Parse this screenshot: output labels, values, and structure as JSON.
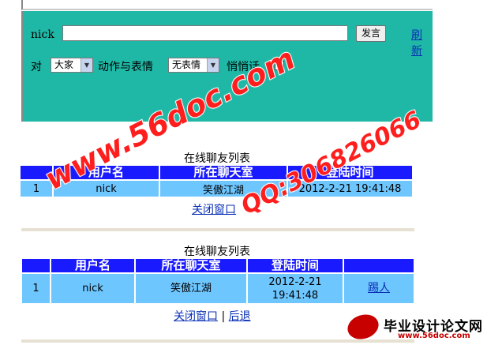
{
  "chat": {
    "nick_label": "nick",
    "message_value": "",
    "speak_button": "发言",
    "refresh_link": "刷新",
    "to_label": "对",
    "target_select": "大家",
    "action_label": "动作与表情",
    "action_select": "无表情",
    "whisper_label": "悄悄话"
  },
  "table1": {
    "title": "在线聊友列表",
    "headers": [
      "",
      "用户名",
      "所在聊天室",
      "登陆时间"
    ],
    "rows": [
      [
        "1",
        "nick",
        "笑傲江湖",
        "2012-2-21 19:41:48"
      ]
    ],
    "close_link": "关闭窗口"
  },
  "table2": {
    "title": "在线聊友列表",
    "headers": [
      "",
      "用户名",
      "所在聊天室",
      "登陆时间",
      ""
    ],
    "rows": [
      [
        "1",
        "nick",
        "笑傲江湖",
        "2012-2-21 19:41:48",
        "踢人"
      ]
    ],
    "close_link": "关闭窗口",
    "separator": "|",
    "back_link": "后退"
  },
  "watermark": {
    "site": "www.56doc.com",
    "qq": "QQ:306826066",
    "logo_text": "毕业设计论文网",
    "logo_url": "www.56doc.com"
  },
  "colors": {
    "panel": "#1fb8a6",
    "header": "#1a1aff",
    "cell": "#6ec6ff",
    "link": "#0a2fb5"
  }
}
